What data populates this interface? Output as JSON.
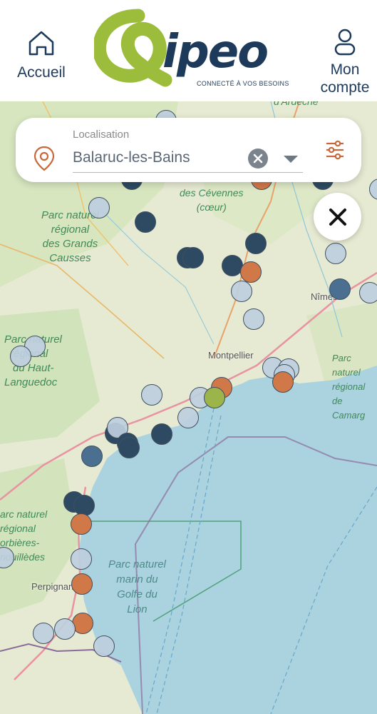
{
  "header": {
    "home_label": "Accueil",
    "account_label_line1": "Mon",
    "account_label_line2": "compte",
    "logo_text": "ipeo",
    "logo_tagline": "CONNECTÉ À VOS BESOINS"
  },
  "search": {
    "label": "Localisation",
    "value": "Balaruc-les-Bains"
  },
  "map": {
    "labels": {
      "ardeche": "d'Ardèche",
      "cevennes_line1": "des Cévennes",
      "cevennes_line2": "(cœur)",
      "grands_causses_line1": "Parc naturel",
      "grands_causses_line2": "régional",
      "grands_causses_line3": "des Grands",
      "grands_causses_line4": "Causses",
      "haut_languedoc_line1": "Parc naturel",
      "haut_languedoc_line2": "régional",
      "haut_languedoc_line3": "du Haut-",
      "haut_languedoc_line4": "Languedoc",
      "camargue_line1": "Parc naturel",
      "camargue_line2": "régional",
      "camargue_line3": "de Camarg",
      "corbieres_line1": "arc naturel",
      "corbieres_line2": "régional",
      "corbieres_line3": "orbières-",
      "corbieres_line4": "nouillèdes",
      "golfe_line1": "Parc naturel",
      "golfe_line2": "marin du",
      "golfe_line3": "Golfe du",
      "golfe_line4": "Lion"
    },
    "cities": {
      "montpellier": "Montpellier",
      "nimes": "Nîmes",
      "perpignan": "Perpignan"
    }
  },
  "colors": {
    "brand_green": "#9cbd3b",
    "brand_navy": "#1e3a5a",
    "accent_orange": "#c8683a",
    "sea": "#aad3df"
  }
}
